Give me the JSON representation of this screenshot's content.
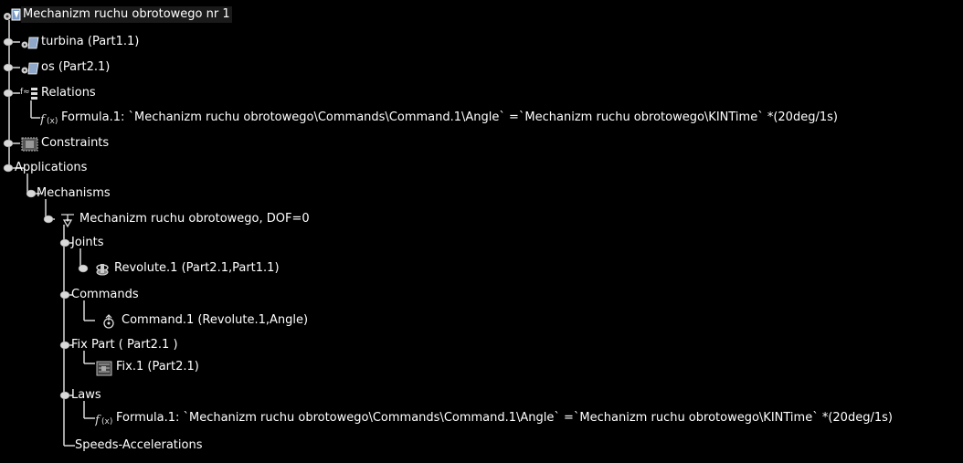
{
  "tree": {
    "root": "Mechanizm ruchu obrotowego nr 1",
    "turbina": "turbina (Part1.1)",
    "os": "os (Part2.1)",
    "relations": "Relations",
    "relations_formula": "Formula.1: `Mechanizm ruchu obrotowego\\Commands\\Command.1\\Angle` =`Mechanizm ruchu obrotowego\\KINTime` *(20deg/1s)",
    "constraints": "Constraints",
    "applications": "Applications",
    "mechanisms": "Mechanisms",
    "mechanism": "Mechanizm ruchu obrotowego, DOF=0",
    "joints": "Joints",
    "revolute": "Revolute.1 (Part2.1,Part1.1)",
    "commands": "Commands",
    "command": "Command.1 (Revolute.1,Angle)",
    "fix_part": "Fix Part ( Part2.1 )",
    "fix": "Fix.1 (Part2.1)",
    "laws": "Laws",
    "laws_formula": "Formula.1: `Mechanizm ruchu obrotowego\\Commands\\Command.1\\Angle` =`Mechanizm ruchu obrotowego\\KINTime` *(20deg/1s)",
    "speeds": "Speeds-Accelerations"
  },
  "icons": {
    "root": "product-icon",
    "turbina": "part-icon",
    "os": "part-icon",
    "relations": "relations-icon",
    "relations_formula": "formula-icon",
    "constraints": "constraints-icon",
    "mechanism": "mechanism-icon",
    "revolute": "revolute-joint-icon",
    "command": "command-icon",
    "fix": "fix-icon",
    "laws_formula": "formula-icon"
  },
  "colors": {
    "background": "#000000",
    "text": "#ffffff",
    "tree_lines": "#d8d8d8"
  }
}
